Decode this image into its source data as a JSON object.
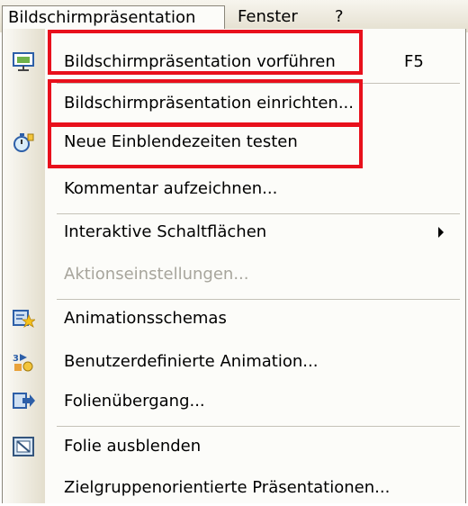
{
  "menubar": {
    "active": "Bildschirmpräsentation",
    "fenster": "Fenster",
    "help": "?"
  },
  "menu": {
    "items": [
      {
        "label": "Bildschirmpräsentation vorführen",
        "shortcut": "F5",
        "icon": "slideshow-screen-icon"
      },
      {
        "label": "Bildschirmpräsentation einrichten..."
      },
      {
        "label": "Neue Einblendezeiten testen",
        "icon": "stopwatch-icon"
      },
      {
        "label": "Kommentar aufzeichnen..."
      },
      {
        "label": "Interaktive Schaltflächen",
        "has_submenu": true
      },
      {
        "label": "Aktionseinstellungen...",
        "disabled": true
      },
      {
        "label": "Animationsschemas",
        "icon": "animation-schemes-icon"
      },
      {
        "label": "Benutzerdefinierte Animation...",
        "icon": "custom-animation-icon"
      },
      {
        "label": "Folienübergang...",
        "icon": "slide-transition-icon"
      },
      {
        "label": "Folie ausblenden",
        "icon": "hide-slide-icon"
      },
      {
        "label": "Zielgruppenorientierte Präsentationen..."
      }
    ]
  },
  "colors": {
    "highlight_box": "#e8101c",
    "disabled_text": "#a7a59c",
    "menu_background": "#fcfcf9"
  }
}
